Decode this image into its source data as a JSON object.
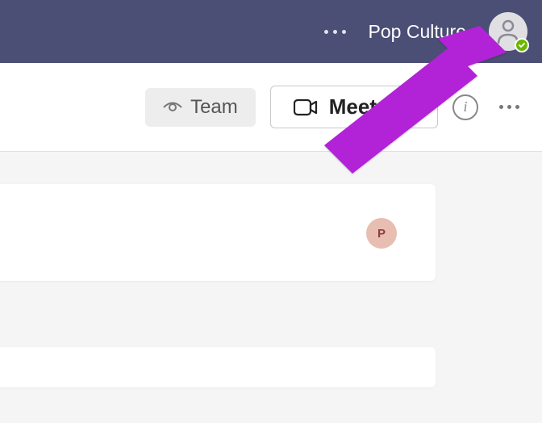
{
  "titlebar": {
    "title": "Pop Culture"
  },
  "toolbar": {
    "team_label": "Team",
    "meet_label": "Meet"
  },
  "message": {
    "avatar_initial": "P"
  },
  "colors": {
    "brand": "#4b4e75",
    "arrow": "#b224d6",
    "presence": "#6bb700"
  }
}
